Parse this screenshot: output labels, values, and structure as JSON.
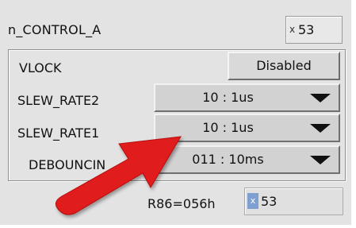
{
  "panel": {
    "title": "n_CONTROL_A",
    "hex_prefix": "x",
    "hex_value": "53"
  },
  "fields": [
    {
      "label": "VLOCK",
      "value": "Disabled",
      "kind": "button"
    },
    {
      "label": "SLEW_RATE2",
      "value": "10 : 1us",
      "kind": "dropdown"
    },
    {
      "label": "SLEW_RATE1",
      "value": "10 : 1us",
      "kind": "dropdown"
    },
    {
      "label": "DEBOUNCIN",
      "value": "011 : 10ms",
      "kind": "dropdown"
    }
  ],
  "register": {
    "label": "R86=056h",
    "value_prefix": "x",
    "value": "53"
  },
  "colors": {
    "panel_bg": "#e3e3e3",
    "arrow": "#e02020"
  }
}
